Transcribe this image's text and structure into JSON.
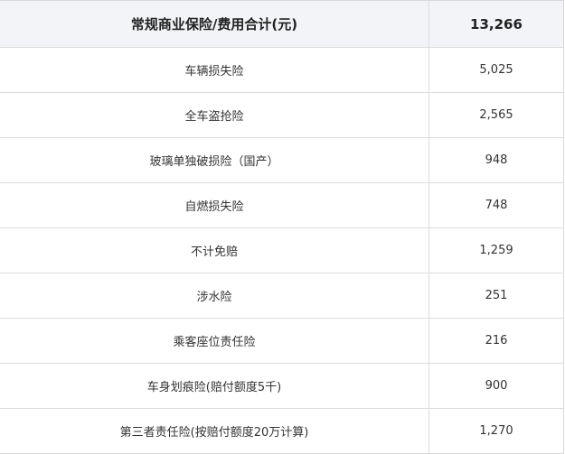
{
  "header": {
    "title": "常规商业保险/费用合计(元)",
    "total": "13,266"
  },
  "rows": [
    {
      "name": "车辆损失险",
      "value": "5,025"
    },
    {
      "name": "全车盗抢险",
      "value": "2,565"
    },
    {
      "name": "玻璃单独破损险（国产）",
      "value": "948"
    },
    {
      "name": "自燃损失险",
      "value": "748"
    },
    {
      "name": "不计免赔",
      "value": "1,259"
    },
    {
      "name": "涉水险",
      "value": "251"
    },
    {
      "name": "乘客座位责任险",
      "value": "216"
    },
    {
      "name": "车身划痕险(赔付额度5千)",
      "value": "900"
    },
    {
      "name": "第三者责任险(按赔付额度20万计算)",
      "value": "1,270"
    }
  ]
}
